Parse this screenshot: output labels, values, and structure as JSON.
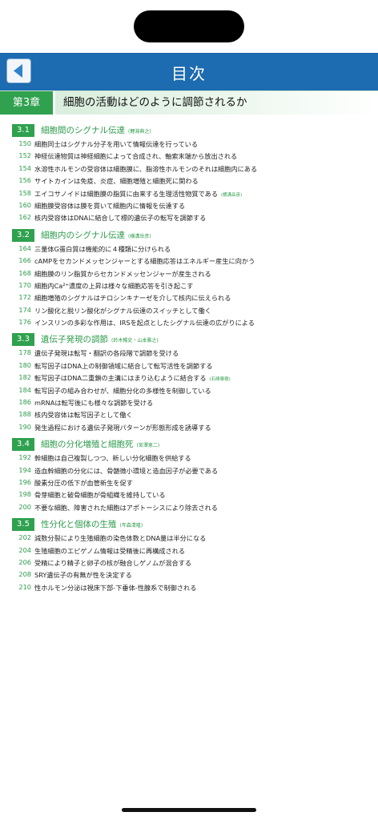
{
  "header": {
    "title": "目次"
  },
  "chapter": {
    "label": "第3章",
    "title": "細胞の活動はどのように調節されるか"
  },
  "sections": [
    {
      "num": "3.1",
      "title": "細胞間のシグナル伝達",
      "author": "(鯉淵典之)",
      "entries": [
        {
          "page": "150",
          "text": "細胞同士はシグナル分子を用いて情報伝達を行っている",
          "author": ""
        },
        {
          "page": "152",
          "text": "神経伝達物質は神経細胞によって合成され、軸索末端から放出される",
          "author": ""
        },
        {
          "page": "154",
          "text": "水溶性ホルモンの受容体は細胞膜に、脂溶性ホルモンのそれは細胞内にある",
          "author": ""
        },
        {
          "page": "156",
          "text": "サイトカインは免疫、炎症、細胞増殖と細胞死に関わる",
          "author": ""
        },
        {
          "page": "158",
          "text": "エイコサノイドは細胞膜の脂質に由来する生理活性物質である",
          "author": "(横溝岳彦)"
        },
        {
          "page": "160",
          "text": "細胞膜受容体は膜を貫いて細胞内に情報を伝達する",
          "author": ""
        },
        {
          "page": "162",
          "text": "核内受容体はDNAに結合して標的遺伝子の転写を調節する",
          "author": ""
        }
      ]
    },
    {
      "num": "3.2",
      "title": "細胞内のシグナル伝達",
      "author": "(横溝岳彦)",
      "entries": [
        {
          "page": "164",
          "text": "三量体G蛋白質は機能的に４種類に分けられる",
          "author": ""
        },
        {
          "page": "166",
          "text": "cAMPをセカンドメッセンジャーとする細胞応答はエネルギー産生に向かう",
          "author": ""
        },
        {
          "page": "168",
          "text": "細胞膜のリン脂質からセカンドメッセンジャーが産生される",
          "author": ""
        },
        {
          "page": "170",
          "text": "細胞内Ca²⁺濃度の上昇は様々な細胞応答を引き起こす",
          "author": ""
        },
        {
          "page": "172",
          "text": "細胞増殖のシグナルはチロシンキナーゼを介して核内に伝えられる",
          "author": ""
        },
        {
          "page": "174",
          "text": "リン酸化と脱リン酸化がシグナル伝達のスイッチとして働く",
          "author": ""
        },
        {
          "page": "176",
          "text": "インスリンの多彩な作用は、IRSを起点としたシグナル伝達の広がりによる",
          "author": ""
        }
      ]
    },
    {
      "num": "3.3",
      "title": "遺伝子発現の調節",
      "author": "(鈴木暢史・山本雅之)",
      "entries": [
        {
          "page": "178",
          "text": "遺伝子発現は転写・翻訳の各段階で調節を受ける",
          "author": ""
        },
        {
          "page": "180",
          "text": "転写因子はDNA上の制御領域に結合して転写活性を調節する",
          "author": ""
        },
        {
          "page": "182",
          "text": "転写因子はDNA二重鎖の主溝にはまり込むように結合する",
          "author": "(石崎泰樹)"
        },
        {
          "page": "184",
          "text": "転写因子の組み合わせが、細胞分化の多様性を制御している",
          "author": ""
        },
        {
          "page": "186",
          "text": "mRNAは転写後にも様々な調節を受ける",
          "author": ""
        },
        {
          "page": "188",
          "text": "核内受容体は転写因子として働く",
          "author": ""
        },
        {
          "page": "190",
          "text": "発生過程における遺伝子発現パターンが形態形成を誘導する",
          "author": ""
        }
      ]
    },
    {
      "num": "3.4",
      "title": "細胞の分化増殖と細胞死",
      "author": "(宮澤恵二)",
      "entries": [
        {
          "page": "192",
          "text": "幹細胞は自己複製しつつ、新しい分化細胞を供給する",
          "author": ""
        },
        {
          "page": "194",
          "text": "造血幹細胞の分化には、骨髄微小環境と造血因子が必要である",
          "author": ""
        },
        {
          "page": "196",
          "text": "酸素分圧の低下が血管新生を促す",
          "author": ""
        },
        {
          "page": "198",
          "text": "骨芽細胞と破骨細胞が骨組織を維持している",
          "author": ""
        },
        {
          "page": "200",
          "text": "不要な細胞、障害された細胞はアポトーシスにより除去される",
          "author": ""
        }
      ]
    },
    {
      "num": "3.5",
      "title": "性分化と個体の生殖",
      "author": "(年森清隆)",
      "entries": [
        {
          "page": "202",
          "text": "減数分裂により生殖細胞の染色体数とDNA量は半分になる",
          "author": ""
        },
        {
          "page": "204",
          "text": "生殖細胞のエピゲノム情報は受精後に再構成される",
          "author": ""
        },
        {
          "page": "206",
          "text": "受精により精子と卵子の核が融合しゲノムが混合する",
          "author": ""
        },
        {
          "page": "208",
          "text": "SRY遺伝子の有無が性を決定する",
          "author": ""
        },
        {
          "page": "210",
          "text": "性ホルモン分泌は視床下部-下垂体-性腺系で制御される",
          "author": ""
        }
      ]
    }
  ],
  "colors": {
    "header": "#1d6bb0",
    "accent_green": "#30a14f",
    "text_green": "#2e9b4c"
  }
}
